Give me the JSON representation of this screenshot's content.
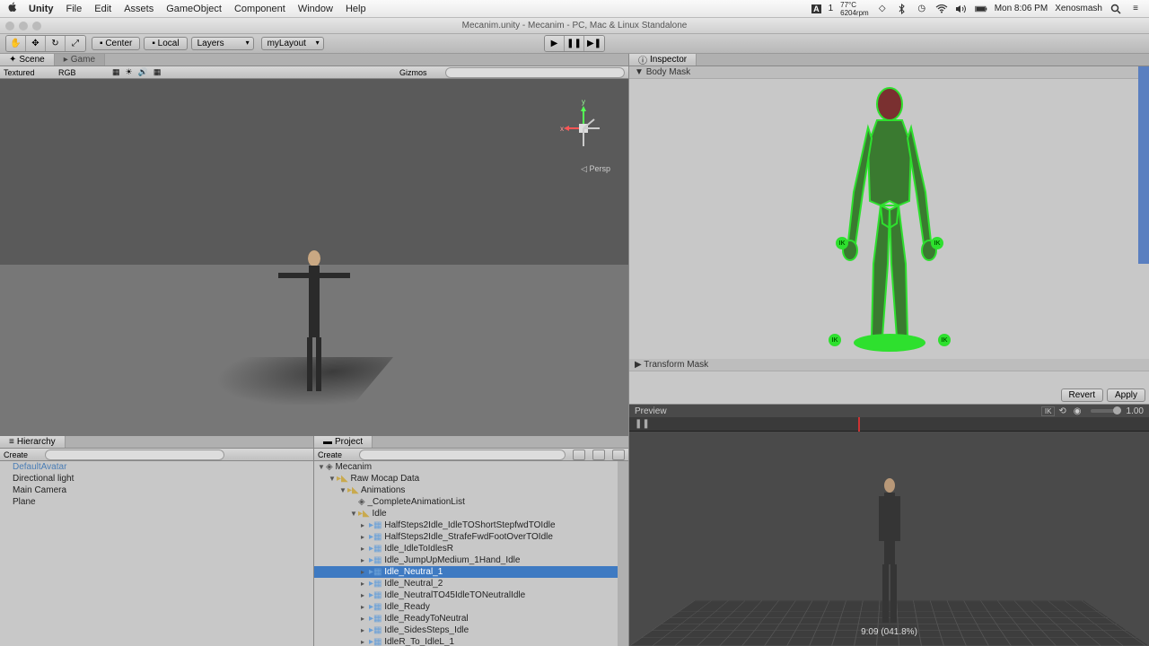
{
  "menubar": {
    "app": "Unity",
    "items": [
      "File",
      "Edit",
      "Assets",
      "GameObject",
      "Component",
      "Window",
      "Help"
    ],
    "temp": "77°C",
    "rpm": "6204rpm",
    "adobe_count": "1",
    "day_time": "Mon 8:06 PM",
    "user": "Xenosmash"
  },
  "titlebar": "Mecanim.unity - Mecanim - PC, Mac & Linux Standalone",
  "toolbar": {
    "center": "Center",
    "local": "Local",
    "layers": "Layers",
    "layout": "myLayout"
  },
  "tabs": {
    "scene": "Scene",
    "game": "Game",
    "hierarchy": "Hierarchy",
    "project": "Project",
    "inspector": "Inspector"
  },
  "scene": {
    "shading": "Textured",
    "render": "RGB",
    "gizmos": "Gizmos",
    "persp": "Persp"
  },
  "hierarchy": {
    "create": "Create",
    "items": [
      "DefaultAvatar",
      "Directional light",
      "Main Camera",
      "Plane"
    ]
  },
  "project": {
    "create": "Create",
    "root": "Mecanim",
    "folder1": "Raw Mocap Data",
    "folder2": "Animations",
    "complete": "_CompleteAnimationList",
    "idle": "Idle",
    "anims": [
      "HalfSteps2Idle_IdleTOShortStepfwdTOIdle",
      "HalfSteps2Idle_StrafeFwdFootOverTOIdle",
      "Idle_IdleToIdlesR",
      "Idle_JumpUpMedium_1Hand_Idle",
      "Idle_Neutral_1",
      "Idle_Neutral_2",
      "Idle_NeutralTO45IdleTONeutralIdle",
      "Idle_Ready",
      "Idle_ReadyToNeutral",
      "Idle_SidesSteps_Idle",
      "IdleR_To_IdleL_1"
    ],
    "selected_index": 4
  },
  "inspector": {
    "body_mask": "Body Mask",
    "transform_mask": "Transform Mask",
    "revert": "Revert",
    "apply": "Apply",
    "ik": "IK"
  },
  "preview": {
    "title": "Preview",
    "ik": "IK",
    "speed": "1.00",
    "time": "9:09 (041.8%)"
  }
}
